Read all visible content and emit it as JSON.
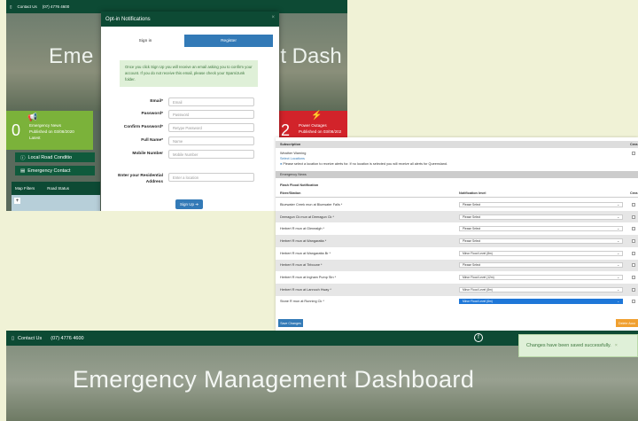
{
  "panel_a": {
    "topbar": {
      "contact_label": "Contact Us",
      "phone": "(07) 4776 4600"
    },
    "hero_left": "Eme",
    "hero_right": "nt Dash",
    "tiles": {
      "green": {
        "count": "0",
        "label": "Emergency News",
        "published": "Published on 03/08/2020",
        "more": "Latest"
      },
      "red": {
        "count": "2",
        "label": "Power Outages",
        "published": "Published on 03/08/202"
      }
    },
    "bars": [
      "Local Road Conditio",
      "Emergency Contact"
    ],
    "filters": {
      "map_filters": "Map Filters",
      "road_status": "Road Status"
    },
    "modal": {
      "title": "Opt-in Notifications",
      "tab_signin": "Sign in",
      "tab_register": "Register",
      "info": "Once you click Sign Up you will receive an email asking you to confirm your account. If you do not receive this email, please check your Spam/Junk folder.",
      "fields": [
        {
          "label": "Email*",
          "placeholder": "Email"
        },
        {
          "label": "Password*",
          "placeholder": "Password"
        },
        {
          "label": "Confirm Password*",
          "placeholder": "Retype Password"
        },
        {
          "label": "Full Name*",
          "placeholder": "Name"
        },
        {
          "label": "Mobile Number",
          "placeholder": "Mobile Number"
        }
      ],
      "address": {
        "label": "Enter your Residential Address",
        "placeholder": "Enter a location"
      },
      "signup": "Sign Up ➔"
    }
  },
  "panel_b": {
    "subscription_header": "Subscription",
    "col_right_header": "Crea",
    "weather": {
      "title": "Weather Warning",
      "link": "Select Locations",
      "note": "Please select a location to receive alerts for. If no location is selected you will receive all alerts for Queensland."
    },
    "emergency_news": "Emergency News",
    "flood_section": "Flash Flood Notification",
    "columns": {
      "river": "River/Station",
      "level": "Notification level",
      "right": "Crea"
    },
    "rows": [
      {
        "station": "Bluewater Creek mun at Bluewater Falls *",
        "level": "Please Select"
      },
      {
        "station": "Deeragun Ck mun at Deeragun Ck *",
        "level": "Please Select"
      },
      {
        "station": "Herbert R mun at Glenealgh *",
        "level": "Please Select"
      },
      {
        "station": "Herbert R mun at Wangaratta *",
        "level": "Please Select"
      },
      {
        "station": "Herbert R mun at Wangaratta Br *",
        "level": "Minor Flood Level (8m)"
      },
      {
        "station": "Herbert R mun at Tirboune *",
        "level": "Please Select"
      },
      {
        "station": "Herbert R mun at Ingham Pump Stn *",
        "level": "Minor Flood Level (12m)"
      },
      {
        "station": "Herbert R mun at Lannoch Hway *",
        "level": "Minor Flood Level (8m)"
      },
      {
        "station": "Stone R mun at Running Ck *",
        "level": "Minor Flood Level (6m)"
      }
    ],
    "save_button": "Save Changes",
    "orange_button": "Delete Acco"
  },
  "panel_c": {
    "topbar": {
      "contact_label": "Contact Us",
      "phone": "(07) 4776 4600"
    },
    "title": "Emergency Management Dashboard",
    "toast": "Changes have been saved successfully."
  },
  "colors": {
    "brand_green": "#0d4a34",
    "primary_blue": "#337ab7",
    "tile_green": "#7bb23a",
    "tile_red": "#d2232a",
    "success_bg": "#dff0d8",
    "page_bg": "#f0f2d6"
  }
}
